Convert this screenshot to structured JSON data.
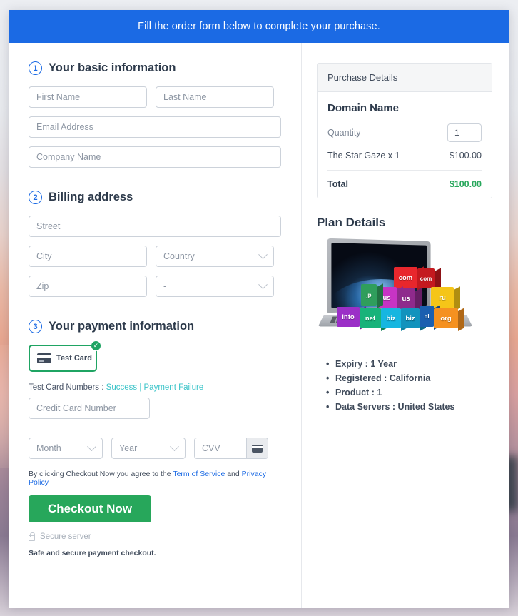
{
  "banner": {
    "text": "Fill the order form below to complete your purchase."
  },
  "basic": {
    "step": "1",
    "title": "Your basic information",
    "first_name_placeholder": "First Name",
    "last_name_placeholder": "Last Name",
    "email_placeholder": "Email Address",
    "company_placeholder": "Company Name"
  },
  "billing": {
    "step": "2",
    "title": "Billing address",
    "street_placeholder": "Street",
    "city_placeholder": "City",
    "country_placeholder": "Country",
    "zip_placeholder": "Zip",
    "state_placeholder": "-"
  },
  "payment": {
    "step": "3",
    "title": "Your payment information",
    "card_option_label": "Test Card",
    "check_mark": "✓",
    "test_label": "Test Card Numbers : ",
    "success_link": "Success",
    "separator": " | ",
    "failure_link": "Payment Failure",
    "card_number_placeholder": "Credit Card Number",
    "month_placeholder": "Month",
    "year_placeholder": "Year",
    "cvv_placeholder": "CVV",
    "agree_prefix": "By clicking Checkout Now you agree to the ",
    "terms_link": "Term of Service",
    "agree_and": " and ",
    "privacy_link": "Privacy Policy",
    "checkout_label": "Checkout Now",
    "secure_label": "Secure server",
    "safe_note": "Safe and secure payment checkout."
  },
  "purchase": {
    "panel_title": "Purchase Details",
    "product_title": "Domain Name",
    "quantity_label": "Quantity",
    "quantity_value": "1",
    "item_label": "The Star Gaze x 1",
    "item_price": "$100.00",
    "total_label": "Total",
    "total_price": "$100.00"
  },
  "plan": {
    "title": "Plan Details",
    "cubes": [
      {
        "label": "com"
      },
      {
        "label": "com"
      },
      {
        "label": "ru"
      },
      {
        "label": "us"
      },
      {
        "label": "us"
      },
      {
        "label": "jp"
      },
      {
        "label": "info"
      },
      {
        "label": "net"
      },
      {
        "label": "biz"
      },
      {
        "label": "biz"
      },
      {
        "label": "nl"
      },
      {
        "label": "org"
      }
    ],
    "details": [
      "Expiry : 1 Year",
      "Registered : California",
      "Product : 1",
      "Data Servers : United States"
    ]
  },
  "colors": {
    "banner_blue": "#1b6ae4",
    "accent_green": "#27a75b",
    "card_border_green": "#1fa463",
    "link_teal": "#3bc4c9",
    "link_blue": "#1b6ae4"
  }
}
